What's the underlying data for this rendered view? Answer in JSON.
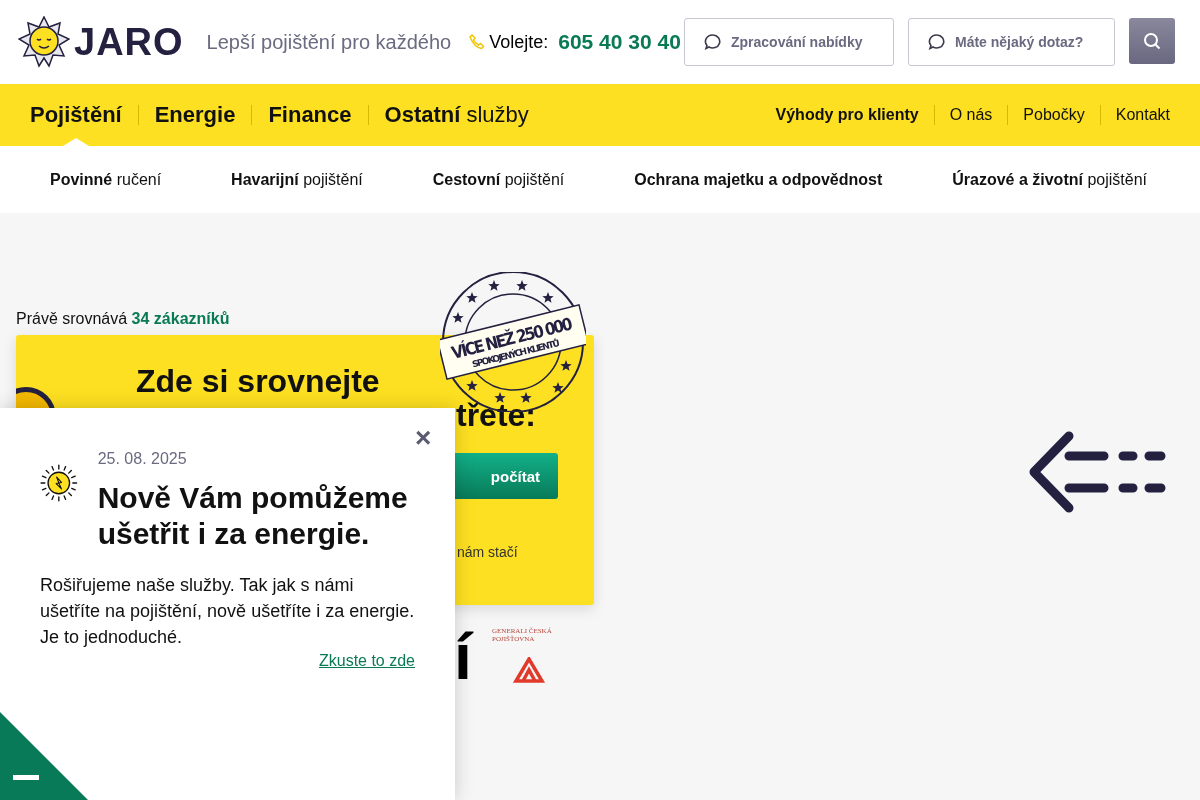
{
  "header": {
    "logo_text": "JARO",
    "tagline": "Lepší pojištění pro každého",
    "phone_label": "Volejte:",
    "phone": "605 40 30 40",
    "buttons": [
      {
        "label": "Zpracování nabídky"
      },
      {
        "label": "Máte nějaký dotaz?"
      }
    ]
  },
  "main_nav": {
    "items": [
      {
        "label": "**Pojištění**",
        "selected": true
      },
      {
        "label": "**Energie**",
        "selected": false
      },
      {
        "label": "**Finance**",
        "selected": false
      },
      {
        "label": "**Ostatní** služby",
        "selected": false
      }
    ],
    "links": [
      {
        "label": "**Výhody pro klienty**"
      },
      {
        "label": "O nás"
      },
      {
        "label": "Pobočky"
      },
      {
        "label": "Kontakt"
      }
    ]
  },
  "sub_nav": [
    {
      "label": "**Povinné** ručení"
    },
    {
      "label": "**Havarijní** pojištění"
    },
    {
      "label": "**Cestovní** pojištění"
    },
    {
      "label": "**Ochrana majetku a odpovědnost**"
    },
    {
      "label": "**Úrazové a životní** pojištění"
    }
  ],
  "hero": {
    "counter": "Právě srovnává **34 zákazníků**",
    "title_line_1": "Zde si srovnejte",
    "title_line_2_visible": "třete:",
    "button": "počítat",
    "note_visible": "nám stačí",
    "stamp": {
      "line_1": "VÍCE NEŽ 250 000",
      "line_2": "SPOKOJENÝCH KLIENTŮ"
    },
    "partner_logos": [
      {
        "text": "GENERALI ČESKÁ POJIŠŤOVNA"
      }
    ],
    "fragment": "í"
  },
  "popup": {
    "date": "25. 08. 2025",
    "title": "Nově Vám pomůžeme ušetřit i za energie.",
    "body": "Rošiřujeme naše služby. Tak jak s námi ušetříte na pojištění, nově ušetříte i za energie. Je to jednoduché.",
    "link": "Zkuste to zde",
    "close": "×"
  }
}
